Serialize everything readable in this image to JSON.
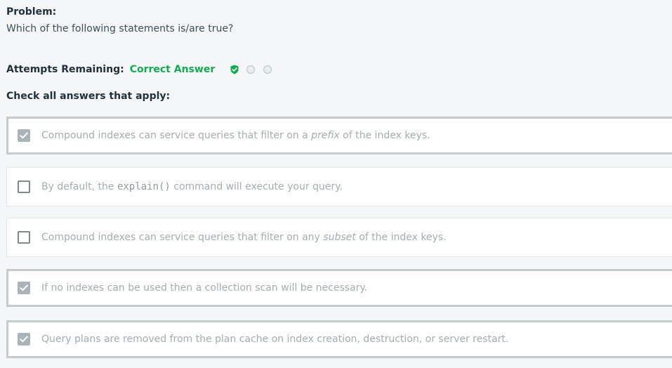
{
  "problem": {
    "title": "Problem:",
    "question": "Which of the following statements is/are true?"
  },
  "attempts": {
    "label": "Attempts Remaining:",
    "status": "Correct Answer",
    "status_color": "#13aa52",
    "dots": [
      {
        "state": "used-correct",
        "icon": "shield-check-icon"
      },
      {
        "state": "unused"
      },
      {
        "state": "unused"
      }
    ]
  },
  "instructions": "Check all answers that apply:",
  "options": [
    {
      "checked": true,
      "before": "Compound indexes can service queries that filter on a ",
      "emphasis": "prefix",
      "after": " of the index keys."
    },
    {
      "checked": false,
      "before": "By default, the ",
      "code": "explain()",
      "after": " command will execute your query."
    },
    {
      "checked": false,
      "before": "Compound indexes can service queries that filter on any ",
      "emphasis": "subset",
      "after": " of the index keys."
    },
    {
      "checked": true,
      "text": "If no indexes can be used then a collection scan will be necessary."
    },
    {
      "checked": true,
      "text": "Query plans are removed from the plan cache on index creation, destruction, or server restart."
    }
  ]
}
